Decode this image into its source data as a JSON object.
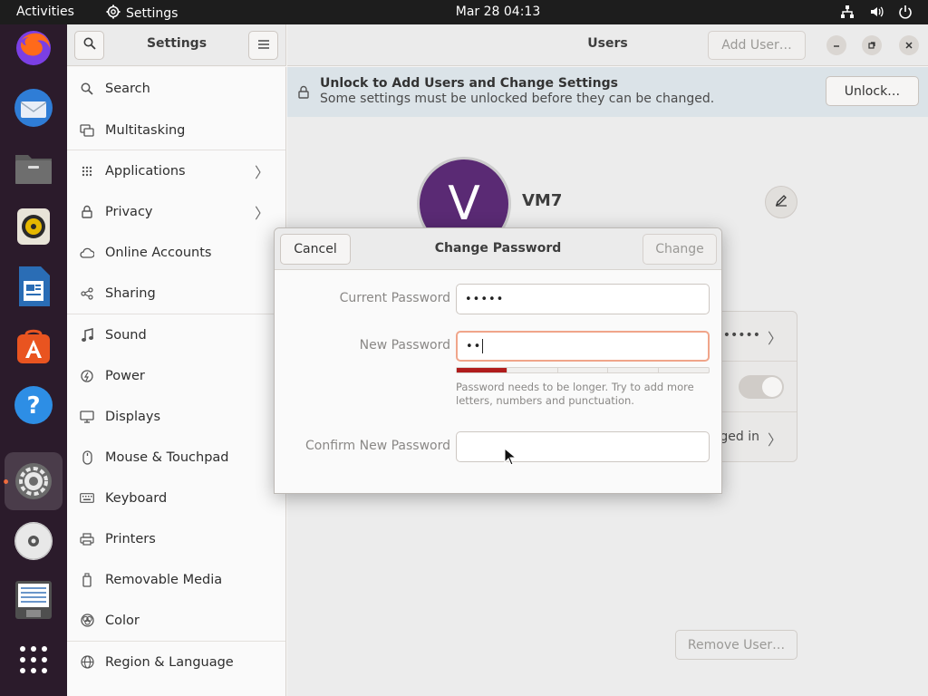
{
  "topbar": {
    "activities": "Activities",
    "app_name": "Settings",
    "clock": "Mar 28  04:13",
    "tray_icons": [
      "network-icon",
      "volume-icon",
      "power-icon"
    ]
  },
  "dock": {
    "apps": [
      "Firefox",
      "Thunderbird",
      "Files",
      "Rhythmbox",
      "LibreOffice Writer",
      "Ubuntu Software",
      "Help",
      "Settings",
      "DVD",
      "Text Editor",
      "Show Applications"
    ],
    "active": "Settings"
  },
  "sidebar": {
    "title": "Settings",
    "items": [
      {
        "label": "Search",
        "icon": "search-icon",
        "chevron": false
      },
      {
        "label": "Multitasking",
        "icon": "multitasking-icon",
        "chevron": false
      },
      {
        "label": "Applications",
        "icon": "grid-icon",
        "chevron": true
      },
      {
        "label": "Privacy",
        "icon": "lock-icon",
        "chevron": true
      },
      {
        "label": "Online Accounts",
        "icon": "cloud-icon",
        "chevron": false
      },
      {
        "label": "Sharing",
        "icon": "share-icon",
        "chevron": false
      },
      {
        "label": "Sound",
        "icon": "music-note-icon",
        "chevron": false
      },
      {
        "label": "Power",
        "icon": "power-icon",
        "chevron": false
      },
      {
        "label": "Displays",
        "icon": "display-icon",
        "chevron": false
      },
      {
        "label": "Mouse & Touchpad",
        "icon": "mouse-icon",
        "chevron": false
      },
      {
        "label": "Keyboard",
        "icon": "keyboard-icon",
        "chevron": false
      },
      {
        "label": "Printers",
        "icon": "printer-icon",
        "chevron": false
      },
      {
        "label": "Removable Media",
        "icon": "removable-media-icon",
        "chevron": false
      },
      {
        "label": "Color",
        "icon": "color-icon",
        "chevron": false
      },
      {
        "label": "Region & Language",
        "icon": "globe-icon",
        "chevron": false
      }
    ]
  },
  "header": {
    "title": "Users",
    "add_user": "Add User…"
  },
  "infobar": {
    "title": "Unlock to Add Users and Change Settings",
    "subtitle": "Some settings must be unlocked before they can be changed.",
    "unlock": "Unlock…"
  },
  "user": {
    "initial": "V",
    "name": "VM7",
    "password_dots": "•••••",
    "autologin_partial": "ged in"
  },
  "remove_user": "Remove User…",
  "dialog": {
    "title": "Change Password",
    "cancel": "Cancel",
    "change": "Change",
    "current_label": "Current Password",
    "current_value": "•••••",
    "new_label": "New Password",
    "new_value": "••",
    "strength_level": 0.2,
    "hint": "Password needs to be longer. Try to add more letters, numbers and punctuation.",
    "confirm_label": "Confirm New Password",
    "confirm_value": ""
  },
  "colors": {
    "accent": "#e95420",
    "strength_weak": "#b01c1c",
    "dock_bg": "#2b1b2b",
    "avatar_bg": "#5a2a74"
  }
}
